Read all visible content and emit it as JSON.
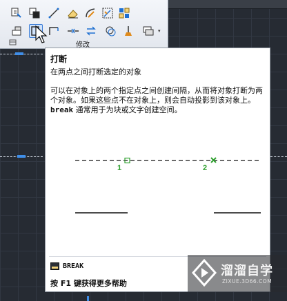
{
  "ribbon": {
    "panel_label": "修改",
    "row1_icons": [
      "copy-properties-icon",
      "array-icon",
      "line-icon",
      "erase-icon",
      "fillet-curve-icon",
      "scale-icon",
      "multi-array-icon"
    ],
    "row2_icons": [
      "stretch-icon",
      "break-icon",
      "corner-icon",
      "join-icon",
      "mirror-icon",
      "offset-icon",
      "brush-icon",
      "group-icon"
    ],
    "dropdown_arrow": "▾"
  },
  "tooltip": {
    "title": "打断",
    "subtitle": "在两点之间打断选定的对象",
    "desc_line1": "可以在对象上的两个指定点之间创建间隔，从而将对象打断为两",
    "desc_line2": "个对象。如果这些点不在对象上，则会自动投影到该对象上。",
    "desc_keyword": "break",
    "desc_line3_rest": " 通常用于为块或文字创建空间。",
    "figure": {
      "point1_label": "1",
      "point2_label": "2"
    },
    "command": "BREAK",
    "help": "按 F1 键获得更多帮助"
  },
  "watermark": {
    "title": "溜溜自学",
    "url": "ZIXUE.3D66.COM"
  },
  "colors": {
    "accent": "#3f8ee8",
    "figure_green": "#2fa02f",
    "canvas": "#262b33"
  }
}
